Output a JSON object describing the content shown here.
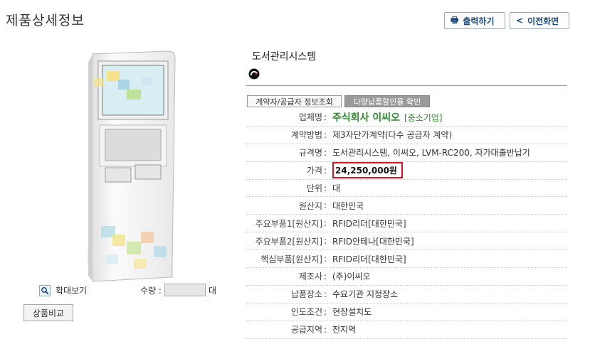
{
  "page": {
    "title": "제품상세정보"
  },
  "toolbar": {
    "print_label": "출력하기",
    "back_label": "이전화면"
  },
  "product": {
    "name": "도서관리시스템"
  },
  "actions": {
    "contractor_info": "계약자/공급자 정보조회",
    "discount_check": "다량납품할인율 확인"
  },
  "left": {
    "zoom_label": "확대보기",
    "qty_label": "수량 :",
    "qty_unit": "대",
    "qty_value": "",
    "compare_label": "상품비교"
  },
  "details": {
    "company": {
      "label": "업체명",
      "value": "주식회사 이씨오",
      "tag": "[중소기업]"
    },
    "contract_method": {
      "label": "계약방법",
      "value": "제3자단가계약(다수 공급자 계약)"
    },
    "spec": {
      "label": "규격명",
      "value": "도서관리시스템, 이씨오, LVM-RC200, 자가대출반납기"
    },
    "price": {
      "label": "가격",
      "value": "24,250,000원"
    },
    "unit": {
      "label": "단위",
      "value": "대"
    },
    "origin": {
      "label": "원산지",
      "value": "대한민국"
    },
    "part1": {
      "label": "주요부품1[원산지]",
      "value": "RFID리더[대한민국]"
    },
    "part2": {
      "label": "주요부품2[원산지]",
      "value": "RFID안테나[대한민국]"
    },
    "core_part": {
      "label": "핵심부품[원산지]",
      "value": "RFID리더[대한민국]"
    },
    "maker": {
      "label": "제조사",
      "value": "(주)이씨오"
    },
    "delivery_place": {
      "label": "납품장소",
      "value": "수요기관 지정장소"
    },
    "delivery_cond": {
      "label": "인도조건",
      "value": "현장설치도"
    },
    "supply_region": {
      "label": "공급지역",
      "value": "전지역"
    }
  },
  "colors": {
    "company_green": "#2e8b2e",
    "price_border": "#d9141a",
    "button_text": "#1a4a80"
  }
}
